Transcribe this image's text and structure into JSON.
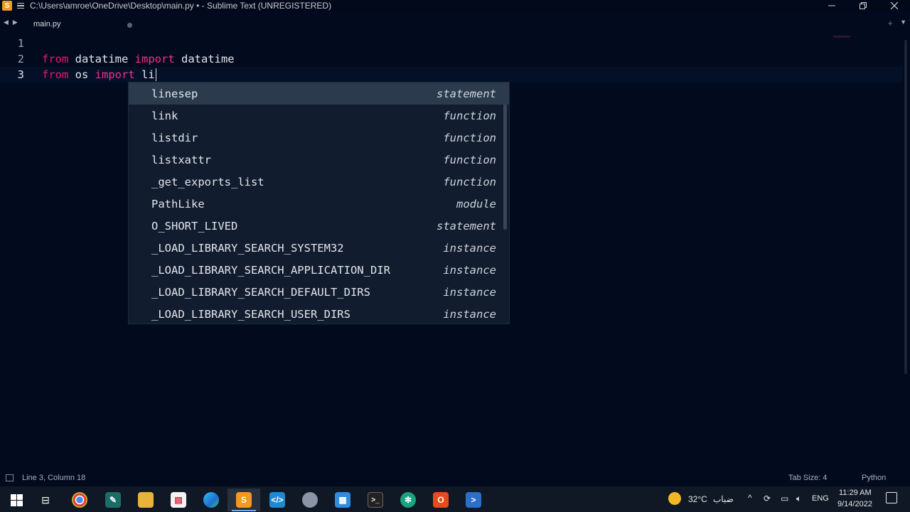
{
  "window": {
    "title": "C:\\Users\\amroe\\OneDrive\\Desktop\\main.py • - Sublime Text (UNREGISTERED)"
  },
  "tabs": [
    {
      "label": "main.py",
      "modified": true
    }
  ],
  "editor": {
    "line_numbers": [
      "1",
      "2",
      "3"
    ],
    "line2": {
      "kw1": "from",
      "mod": " datatime ",
      "kw2": "import",
      "name": " datatime"
    },
    "line3": {
      "kw1": "from",
      "mod": " os ",
      "kw2": "import",
      "typed": " li"
    }
  },
  "autocomplete": {
    "items": [
      {
        "label": "linesep",
        "kind": "statement"
      },
      {
        "label": "link",
        "kind": "function"
      },
      {
        "label": "listdir",
        "kind": "function"
      },
      {
        "label": "listxattr",
        "kind": "function"
      },
      {
        "label": "_get_exports_list",
        "kind": "function"
      },
      {
        "label": "PathLike",
        "kind": "module"
      },
      {
        "label": "O_SHORT_LIVED",
        "kind": "statement"
      },
      {
        "label": "_LOAD_LIBRARY_SEARCH_SYSTEM32",
        "kind": "instance"
      },
      {
        "label": "_LOAD_LIBRARY_SEARCH_APPLICATION_DIR",
        "kind": "instance"
      },
      {
        "label": "_LOAD_LIBRARY_SEARCH_DEFAULT_DIRS",
        "kind": "instance"
      },
      {
        "label": "_LOAD_LIBRARY_SEARCH_USER_DIRS",
        "kind": "instance"
      }
    ],
    "selected_index": 0
  },
  "status": {
    "position": "Line 3, Column 18",
    "tab_size": "Tab Size: 4",
    "syntax": "Python"
  },
  "taskbar": {
    "apps": [
      "start-icon",
      "task-view-icon",
      "chrome-icon",
      "app-icon",
      "file-explorer-icon",
      "files-icon",
      "edge-icon",
      "sublime-text-icon",
      "vscode-icon",
      "app-icon",
      "calculator-icon",
      "terminal-icon",
      "chatgpt-icon",
      "office-icon",
      "powershell-icon"
    ],
    "active_app": "sublime-text-icon",
    "weather_temp": "32°C",
    "weather_desc": "ضباب",
    "language": "ENG",
    "time": "11:29 AM",
    "date": "9/14/2022"
  },
  "colors": {
    "background": "#020b1e",
    "keyword": "#e9156f",
    "popup_bg": "#111c2e",
    "popup_selected": "#2c3a4e"
  }
}
